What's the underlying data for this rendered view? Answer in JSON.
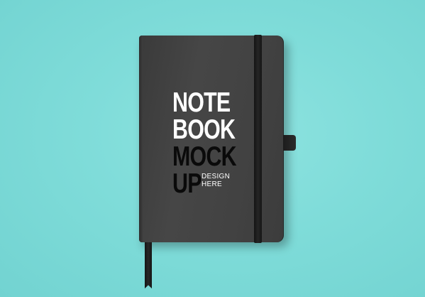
{
  "scene": {
    "background_color": "#7fdcd9",
    "notebook_color": "#424242",
    "band_color": "#1c1c1c"
  },
  "cover_text": {
    "line1": "NOTE",
    "line2": "BOOK",
    "line3": "MOCK",
    "line4": "UP",
    "sub1": "DESIGN",
    "sub2": "HERE"
  }
}
